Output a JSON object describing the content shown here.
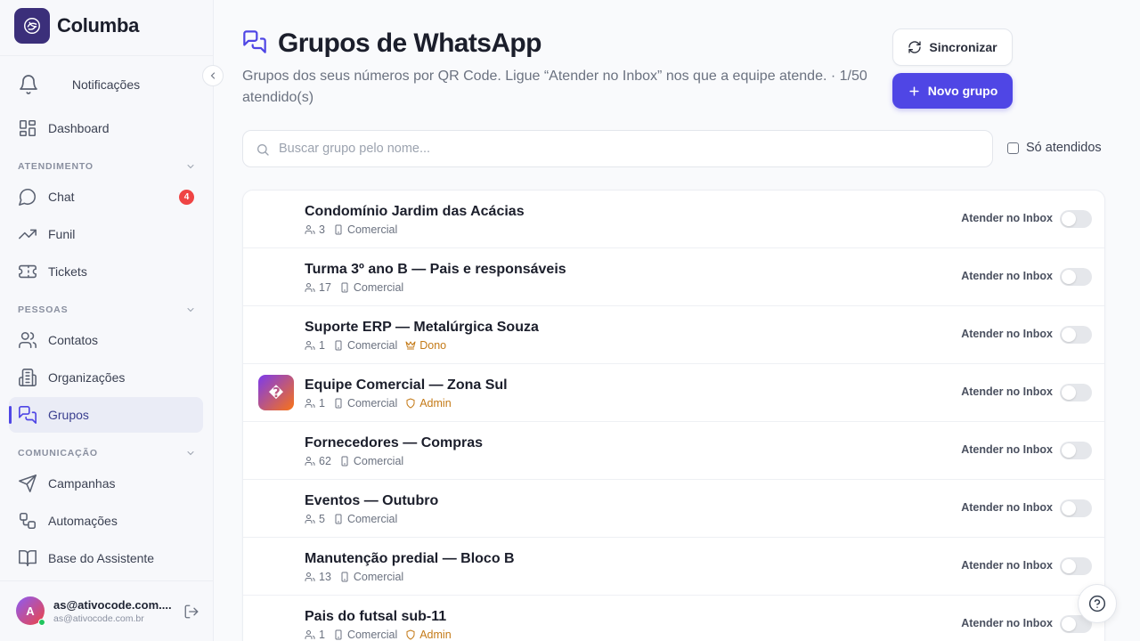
{
  "app": {
    "name": "Columba",
    "brand_color": "#3b2f7a",
    "accent": "#4f46e5"
  },
  "sidebar": {
    "notifications_label": "Notificações",
    "dashboard_label": "Dashboard",
    "sections": {
      "atendimento": "ATENDIMENTO",
      "pessoas": "PESSOAS",
      "comunicacao": "COMUNICAÇÃO"
    },
    "items": {
      "chat": "Chat",
      "chat_badge": "4",
      "funil": "Funil",
      "tickets": "Tickets",
      "contatos": "Contatos",
      "organizacoes": "Organizações",
      "grupos": "Grupos",
      "campanhas": "Campanhas",
      "automacoes": "Automações",
      "base": "Base do Assistente"
    },
    "user": {
      "initial": "A",
      "name": "as@ativocode.com....",
      "email": "as@ativocode.com.br"
    }
  },
  "header": {
    "title": "Grupos de WhatsApp",
    "subtitle": "Grupos dos seus números por QR Code. Ligue “Atender no Inbox” nos que a equipe atende. · 1/50 atendido(s)",
    "sync_label": "Sincronizar",
    "new_label": "Novo grupo"
  },
  "search": {
    "placeholder": "Buscar grupo pelo nome...",
    "value": ""
  },
  "filter": {
    "only_attended_label": "Só atendidos",
    "checked": false
  },
  "groups": [
    {
      "name": "Condomínio Jardim das Acácias",
      "members": "3",
      "channel": "Comercial",
      "role": "",
      "toggle_label": "Atender no Inbox",
      "attended": false
    },
    {
      "name": "Turma 3º ano B — Pais e responsáveis",
      "members": "17",
      "channel": "Comercial",
      "role": "",
      "toggle_label": "Atender no Inbox",
      "attended": false
    },
    {
      "name": "Suporte ERP — Metalúrgica Souza",
      "members": "1",
      "channel": "Comercial",
      "role": "Dono",
      "toggle_label": "Atender no Inbox",
      "attended": false
    },
    {
      "name": "Equipe Comercial — Zona Sul",
      "members": "1",
      "channel": "Comercial",
      "role": "Admin",
      "avatar_glyph": "�",
      "toggle_label": "Atender no Inbox",
      "attended": false
    },
    {
      "name": "Fornecedores — Compras",
      "members": "62",
      "channel": "Comercial",
      "role": "",
      "toggle_label": "Atender no Inbox",
      "attended": false
    },
    {
      "name": "Eventos — Outubro",
      "members": "5",
      "channel": "Comercial",
      "role": "",
      "toggle_label": "Atender no Inbox",
      "attended": false
    },
    {
      "name": "Manutenção predial — Bloco B",
      "members": "13",
      "channel": "Comercial",
      "role": "",
      "toggle_label": "Atender no Inbox",
      "attended": false
    },
    {
      "name": "Pais do futsal sub-11",
      "members": "1",
      "channel": "Comercial",
      "role": "Admin",
      "toggle_label": "Atender no Inbox",
      "attended": false
    }
  ]
}
